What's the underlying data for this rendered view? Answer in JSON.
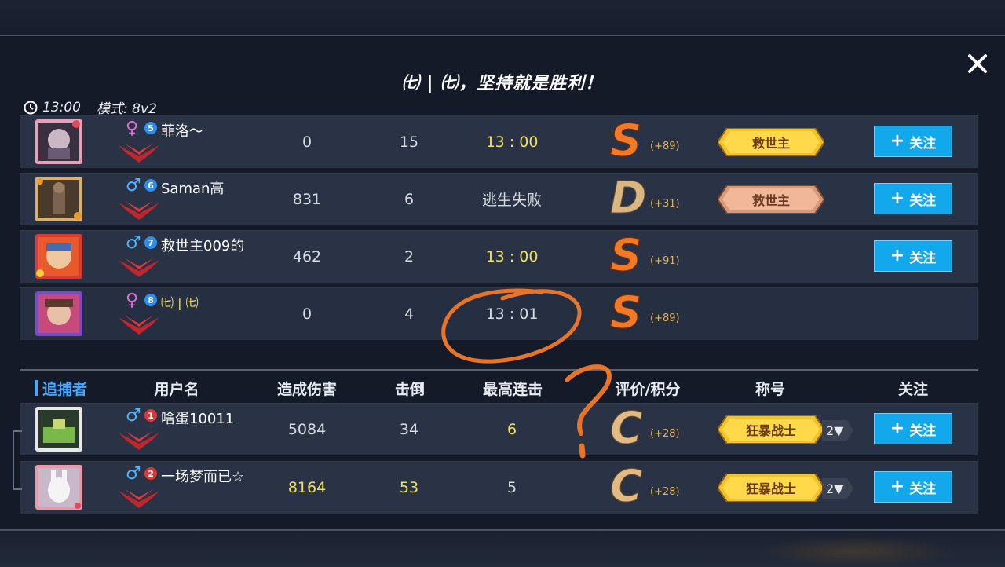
{
  "header": {
    "title": "㈦ | ㈦，坚持就是胜利！",
    "time": "13:00",
    "mode": "模式: 8v2"
  },
  "columns": {
    "team": "追捕者",
    "username": "用户名",
    "damage": "造成伤害",
    "kills": "击倒",
    "combo": "最高连击",
    "rating": "评价/积分",
    "title": "称号",
    "follow": "关注"
  },
  "survivors": [
    {
      "gender": "♀",
      "level": "5",
      "name": "菲洛～",
      "damage": "0",
      "kills": "15",
      "result": "13 : 00",
      "grade": "S",
      "points": "(+89)",
      "badge": "救世主",
      "follow": "关注"
    },
    {
      "gender": "♂",
      "level": "6",
      "name": "Saman高",
      "damage": "831",
      "kills": "6",
      "result": "逃生失败",
      "grade": "D",
      "points": "(+31)",
      "badge": "救世主",
      "follow": "关注"
    },
    {
      "gender": "♂",
      "level": "7",
      "name": "救世主009的",
      "damage": "462",
      "kills": "2",
      "result": "13 : 00",
      "grade": "S",
      "points": "(+91)",
      "follow": "关注"
    },
    {
      "gender": "♀",
      "level": "8",
      "name": "㈦ | ㈦",
      "damage": "0",
      "kills": "4",
      "result": "13 : 01",
      "grade": "S",
      "points": "(+89)"
    }
  ],
  "hunters": [
    {
      "gender": "♂",
      "level": "1",
      "name": "啥蛋10011",
      "damage": "5084",
      "kills": "34",
      "combo": "6",
      "grade": "C",
      "points": "(+28)",
      "badge": "狂暴战士",
      "badge_count": "2▼",
      "follow": "关注"
    },
    {
      "gender": "♂",
      "level": "2",
      "name": "一场梦而已☆",
      "damage": "8164",
      "kills": "53",
      "combo": "5",
      "grade": "C",
      "points": "(+28)",
      "badge": "狂暴战士",
      "badge_count": "2▼",
      "follow": "关注"
    }
  ],
  "colors": {
    "accent_blue": "#13a7ec",
    "highlight_yellow": "#f1e254",
    "annotation_orange": "#e8742a",
    "grade_s": "#f07a26"
  },
  "icons": {
    "close": "close-icon",
    "clock": "clock-icon",
    "plus": "plus-icon"
  }
}
